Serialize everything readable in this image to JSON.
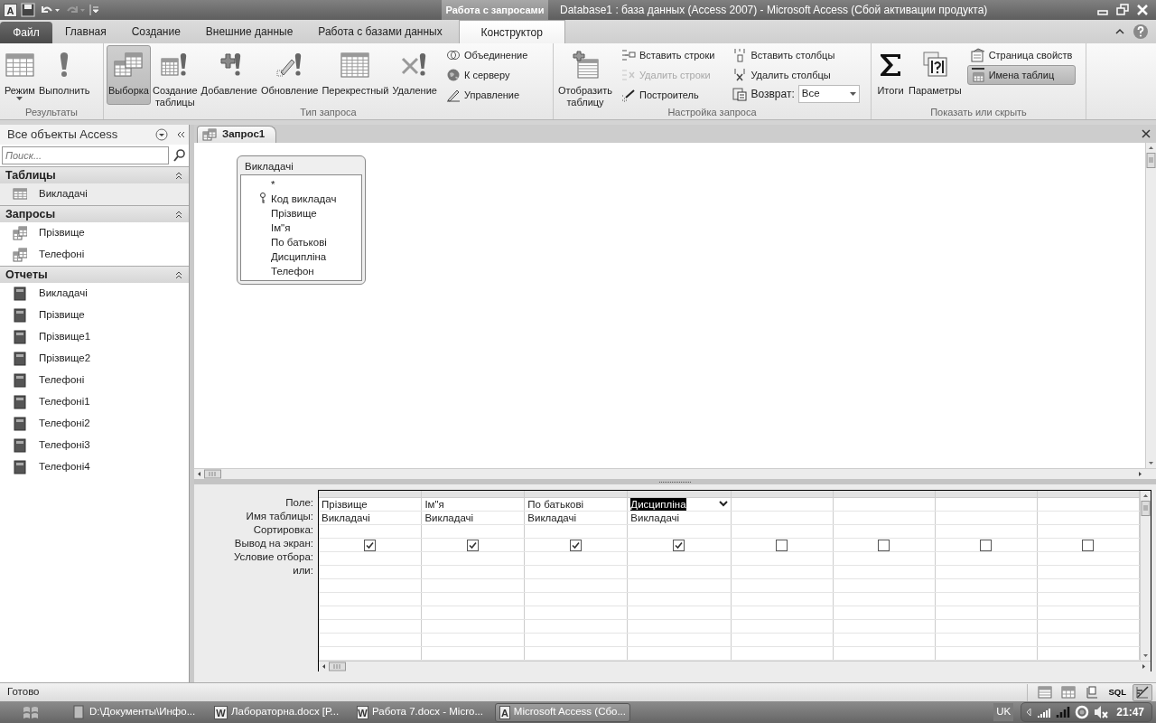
{
  "app_icon_letter": "A",
  "context_group": "Работа с запросами",
  "window": {
    "title": "Database1 : база данных (Access 2007)  -  Microsoft Access (Сбой активации продукта)"
  },
  "tabs": [
    {
      "label": "Файл",
      "kind": "file",
      "selected": false
    },
    {
      "label": "Главная",
      "kind": "tab",
      "selected": false
    },
    {
      "label": "Создание",
      "kind": "tab",
      "selected": false
    },
    {
      "label": "Внешние данные",
      "kind": "tab",
      "selected": false
    },
    {
      "label": "Работа с базами данных",
      "kind": "tab",
      "selected": false
    },
    {
      "label": "Конструктор",
      "kind": "tab",
      "selected": true
    }
  ],
  "ribbon": {
    "groups": [
      {
        "label": "Результаты",
        "controls": [
          {
            "kind": "large",
            "label": "Режим",
            "menu": true,
            "selected": false
          },
          {
            "kind": "large",
            "label": "Выполнить",
            "selected": false
          }
        ]
      },
      {
        "label": "Тип запроса",
        "controls": [
          {
            "kind": "large",
            "label": "Выборка",
            "selected": true
          },
          {
            "kind": "large",
            "label": "Создание\nтаблицы",
            "selected": false
          },
          {
            "kind": "large",
            "label": "Добавление",
            "selected": false
          },
          {
            "kind": "large",
            "label": "Обновление",
            "selected": false
          },
          {
            "kind": "large",
            "label": "Перекрестный",
            "selected": false
          },
          {
            "kind": "large",
            "label": "Удаление",
            "selected": false
          },
          {
            "kind": "stack",
            "items": [
              {
                "kind": "button",
                "label": "Объединение",
                "disabled": false,
                "selected": false
              },
              {
                "kind": "button",
                "label": "К серверу",
                "disabled": false,
                "selected": false
              },
              {
                "kind": "button",
                "label": "Управление",
                "disabled": false,
                "selected": false
              }
            ]
          }
        ]
      },
      {
        "label": "Настройка запроса",
        "controls": [
          {
            "kind": "large",
            "label": "Отобразить\nтаблицу",
            "selected": false
          },
          {
            "kind": "stack",
            "items": [
              {
                "kind": "button",
                "label": "Вставить строки",
                "disabled": false,
                "selected": false
              },
              {
                "kind": "button",
                "label": "Удалить строки",
                "disabled": true,
                "selected": false
              },
              {
                "kind": "button",
                "label": "Построитель",
                "disabled": false,
                "selected": false
              }
            ]
          },
          {
            "kind": "stack",
            "items": [
              {
                "kind": "button",
                "label": "Вставить столбцы",
                "disabled": false,
                "selected": false
              },
              {
                "kind": "button",
                "label": "Удалить столбцы",
                "disabled": false,
                "selected": false
              },
              {
                "kind": "combo",
                "label": "Возврат:",
                "value": "Все"
              }
            ]
          }
        ]
      },
      {
        "label": "Показать или скрыть",
        "controls": [
          {
            "kind": "large",
            "label": "Итоги",
            "selected": false
          },
          {
            "kind": "large",
            "label": "Параметры",
            "selected": false
          },
          {
            "kind": "stack",
            "items": [
              {
                "kind": "button",
                "label": "Страница свойств",
                "disabled": false,
                "selected": false
              },
              {
                "kind": "button",
                "label": "Имена таблиц",
                "disabled": false,
                "selected": true
              }
            ]
          }
        ]
      }
    ]
  },
  "navigation": {
    "title": "Все объекты Access",
    "search": {
      "placeholder": "Поиск..."
    },
    "groups": [
      {
        "label": "Таблицы",
        "kind": "table",
        "items": [
          {
            "label": "Викладачі",
            "selected": true
          }
        ]
      },
      {
        "label": "Запросы",
        "kind": "query",
        "items": [
          {
            "label": "Прізвище",
            "selected": false
          },
          {
            "label": "Телефоні",
            "selected": false
          }
        ]
      },
      {
        "label": "Отчеты",
        "kind": "report",
        "items": [
          {
            "label": "Викладачі",
            "selected": false
          },
          {
            "label": "Прізвище",
            "selected": false
          },
          {
            "label": "Прізвище1",
            "selected": false
          },
          {
            "label": "Прізвище2",
            "selected": false
          },
          {
            "label": "Телефоні",
            "selected": false
          },
          {
            "label": "Телефоні1",
            "selected": false
          },
          {
            "label": "Телефоні2",
            "selected": false
          },
          {
            "label": "Телефоні3",
            "selected": false
          },
          {
            "label": "Телефоні4",
            "selected": false
          }
        ]
      }
    ]
  },
  "document_tab": {
    "label": "Запрос1"
  },
  "table_box": {
    "title": "Викладачі",
    "fields": [
      {
        "label": "*",
        "key": false
      },
      {
        "label": "Код викладач",
        "key": true
      },
      {
        "label": "Прізвище",
        "key": false
      },
      {
        "label": "Ім\"я",
        "key": false
      },
      {
        "label": "По батькові",
        "key": false
      },
      {
        "label": "Дисципліна",
        "key": false
      },
      {
        "label": "Телефон",
        "key": false
      }
    ]
  },
  "design_grid": {
    "row_labels": [
      "Поле:",
      "Имя таблицы:",
      "Сортировка:",
      "Вывод на экран:",
      "Условие отбора:",
      "или:"
    ],
    "columns": [
      {
        "field": "Прізвище",
        "table": "Викладачі",
        "show": true,
        "selected": false
      },
      {
        "field": "Ім\"я",
        "table": "Викладачі",
        "show": true,
        "selected": false
      },
      {
        "field": "По батькові",
        "table": "Викладачі",
        "show": true,
        "selected": false
      },
      {
        "field": "Дисципліна",
        "table": "Викладачі",
        "show": true,
        "selected": true
      },
      {
        "show": false,
        "selected": false
      },
      {
        "show": false,
        "selected": false
      },
      {
        "show": false,
        "selected": false
      },
      {
        "show": false,
        "selected": false
      }
    ]
  },
  "status_bar": {
    "text": "Готово",
    "views": [
      {
        "selected": false
      },
      {
        "selected": false
      },
      {
        "selected": false
      },
      {
        "label": "SQL",
        "selected": false
      },
      {
        "selected": true
      }
    ]
  },
  "taskbar": {
    "items": [
      {
        "label": "D:\\Документы\\Инфо...",
        "selected": false
      },
      {
        "label": "Лабораторна.docx [Р...",
        "icon_letter": "W",
        "selected": false
      },
      {
        "label": "Работа 7.docx - Micro...",
        "icon_letter": "W",
        "selected": false
      },
      {
        "label": "Microsoft Access (Сбо...",
        "icon_letter": "A",
        "selected": true
      }
    ],
    "language": "UK",
    "clock": "21:47"
  }
}
